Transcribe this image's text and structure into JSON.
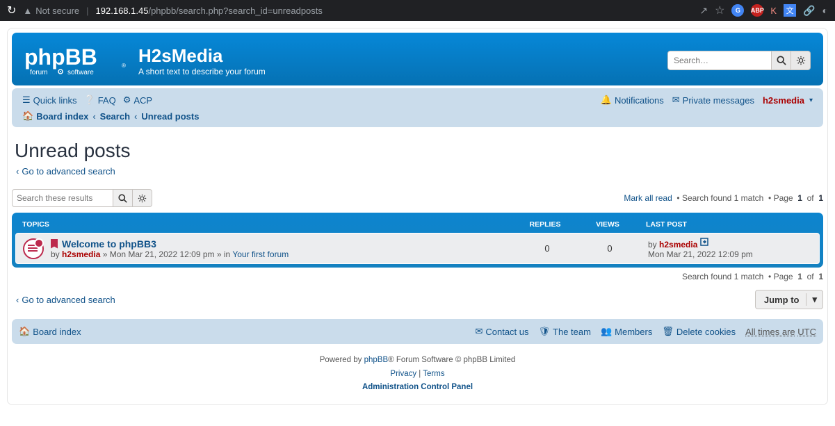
{
  "browser": {
    "not_secure": "Not secure",
    "url_host": "192.168.1.45",
    "url_path": "/phpbb/search.php?search_id=unreadposts"
  },
  "header": {
    "sitename": "H2sMedia",
    "site_desc": "A short text to describe your forum",
    "search_placeholder": "Search…"
  },
  "nav": {
    "quick_links": "Quick links",
    "faq": "FAQ",
    "acp": "ACP",
    "notifications": "Notifications",
    "pm": "Private messages",
    "username": "h2smedia"
  },
  "breadcrumbs": {
    "board_index": "Board index",
    "search": "Search",
    "unread": "Unread posts"
  },
  "page": {
    "title": "Unread posts",
    "adv_search": "Go to advanced search",
    "search_placeholder": "Search these results",
    "mark_all": "Mark all read",
    "found_prefix": "Search found 1 match",
    "page_word": "Page",
    "page_cur": "1",
    "page_of": "of",
    "page_total": "1"
  },
  "cols": {
    "topics": "TOPICS",
    "replies": "REPLIES",
    "views": "VIEWS",
    "last": "LAST POST"
  },
  "topic": {
    "title": "Welcome to phpBB3",
    "by": "by",
    "author": "h2smedia",
    "date": "Mon Mar 21, 2022 12:09 pm",
    "in": "in",
    "forum": "Your first forum",
    "replies": "0",
    "views": "0",
    "last_by": "by",
    "last_author": "h2smedia",
    "last_date": "Mon Mar 21, 2022 12:09 pm"
  },
  "jump": {
    "label": "Jump to"
  },
  "footer": {
    "board_index": "Board index",
    "contact": "Contact us",
    "team": "The team",
    "members": "Members",
    "delete_cookies": "Delete cookies",
    "tz_label": "All times are",
    "tz": "UTC"
  },
  "copyright": {
    "powered": "Powered by",
    "phpbb": "phpBB",
    "rest": "® Forum Software © phpBB Limited",
    "privacy": "Privacy",
    "terms": "Terms",
    "acp": "Administration Control Panel"
  }
}
